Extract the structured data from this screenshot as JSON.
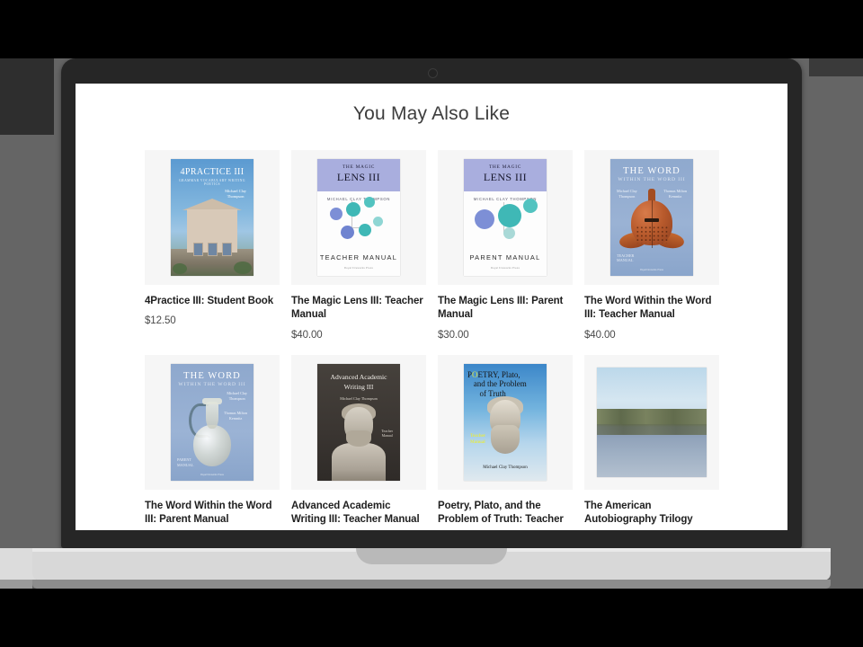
{
  "device": {
    "type": "laptop-mockup",
    "webcam_icon": "camera-dot-icon"
  },
  "page": {
    "heading": "You May Also Like"
  },
  "products": [
    {
      "title": "4Practice III: Student Book",
      "price": "$12.50",
      "cover": {
        "style": "4practice",
        "title": "4PRACTICE III",
        "subtitle": "GRAMMAR  VOCABULARY  WRITING  POETICS",
        "author": "Michael Clay\nThompson"
      }
    },
    {
      "title": "The Magic Lens III: Teacher Manual",
      "price": "$40.00",
      "cover": {
        "style": "magiclens",
        "the": "THE MAGIC",
        "title": "LENS III",
        "author": "MICHAEL CLAY THOMPSON",
        "edition": "TEACHER MANUAL",
        "press": "Royal Fireworks Press"
      }
    },
    {
      "title": "The Magic Lens III: Parent Manual",
      "price": "$30.00",
      "cover": {
        "style": "magiclens",
        "the": "THE MAGIC",
        "title": "LENS III",
        "author": "MICHAEL CLAY THOMPSON",
        "edition": "PARENT MANUAL",
        "press": "Royal Fireworks Press"
      }
    },
    {
      "title": "The Word Within the Word III: Teacher Manual",
      "price": "$40.00",
      "cover": {
        "style": "word-helmet",
        "title": "THE WORD",
        "subtitle": "WITHIN THE WORD III",
        "author_left": "Michael Clay\nThompson",
        "author_right": "Thomas Milton\nKemnitz",
        "kind": "TEACHER\nMANUAL",
        "press": "Royal Fireworks Press"
      }
    },
    {
      "title": "The Word Within the Word III: Parent Manual",
      "price": "",
      "cover": {
        "style": "word-ewer",
        "title": "THE WORD",
        "subtitle": "WITHIN THE WORD III",
        "author_left": "Michael Clay\nThompson",
        "author_right": "Thomas Milton\nKemnitz",
        "kind": "PARENT\nMANUAL",
        "press": "Royal Fireworks Press"
      }
    },
    {
      "title": "Advanced Academic Writing III: Teacher Manual",
      "price": "",
      "cover": {
        "style": "advanced-academic",
        "title": "Advanced Academic\nWriting III",
        "author": "Michael Clay Thompson",
        "kind": "Teacher\nManual"
      }
    },
    {
      "title": "Poetry, Plato, and the Problem of Truth: Teacher",
      "price": "",
      "cover": {
        "style": "poetry-plato",
        "title_lead": "P",
        "title_o": "O",
        "title_rest": "ETRY, Plato,",
        "title_line2": "and the Problem",
        "title_line3": "of Truth",
        "kind": "Teacher\nManual",
        "author": "Michael Clay Thompson"
      }
    },
    {
      "title": "The American Autobiography Trilogy",
      "price": "",
      "cover": {
        "style": "lake-photo",
        "alt": "lake-landscape-photo"
      }
    }
  ]
}
